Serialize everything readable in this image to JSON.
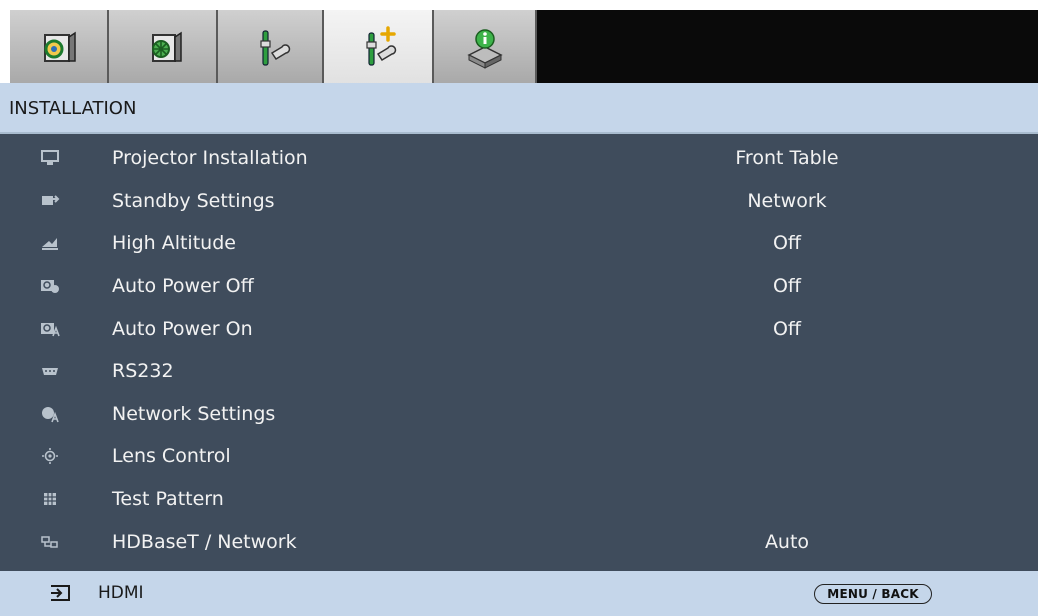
{
  "tabs": [
    {
      "icon": "picture-icon",
      "active": false
    },
    {
      "icon": "image-settings-icon",
      "active": false
    },
    {
      "icon": "setup-tools-icon",
      "active": false
    },
    {
      "icon": "installation-tools-icon",
      "active": true
    },
    {
      "icon": "information-icon",
      "active": false
    }
  ],
  "header": {
    "title": "INSTALLATION"
  },
  "menu": [
    {
      "icon": "projector-installation-icon",
      "label": "Projector Installation",
      "value": "Front Table"
    },
    {
      "icon": "standby-settings-icon",
      "label": "Standby Settings",
      "value": "Network"
    },
    {
      "icon": "high-altitude-icon",
      "label": "High Altitude",
      "value": "Off"
    },
    {
      "icon": "auto-power-off-icon",
      "label": "Auto Power Off",
      "value": "Off"
    },
    {
      "icon": "auto-power-on-icon",
      "label": "Auto Power On",
      "value": "Off"
    },
    {
      "icon": "rs232-icon",
      "label": "RS232",
      "value": ""
    },
    {
      "icon": "network-settings-icon",
      "label": "Network Settings",
      "value": ""
    },
    {
      "icon": "lens-control-icon",
      "label": "Lens Control",
      "value": ""
    },
    {
      "icon": "test-pattern-icon",
      "label": "Test Pattern",
      "value": ""
    },
    {
      "icon": "hdbaset-network-icon",
      "label": "HDBaseT / Network",
      "value": "Auto"
    }
  ],
  "footer": {
    "source": "HDMI",
    "menu_button": "MENU / BACK",
    "source_icon": "input-source-icon"
  },
  "colors": {
    "header_bg": "#c5d6ea",
    "list_bg": "#3f4c5c",
    "text_light": "#f2f2f2"
  }
}
